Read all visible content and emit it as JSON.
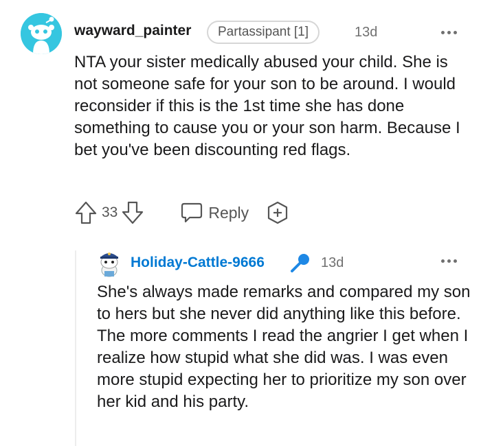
{
  "comment": {
    "author": "wayward_painter",
    "flair": "Partassipant [1]",
    "age": "13d",
    "body": "NTA your sister medically abused your child. She is not someone safe for your son to be around. I would reconsider if this is the 1st time she has done something to cause you or your son harm. Because I bet you've been discounting red flags.",
    "score": "33",
    "reply_label": "Reply",
    "accent_color": "#35c6e0"
  },
  "reply": {
    "author": "Holiday-Cattle-9666",
    "age": "13d",
    "body": "She's always made remarks and compared my son to hers but she never did anything like this before. The more comments I read the angrier I get when I realize how stupid what she did was. I was even more stupid expecting her to prioritize my son over her kid and his party.",
    "author_color": "#0079d3",
    "badge_icon": "microphone-icon"
  }
}
